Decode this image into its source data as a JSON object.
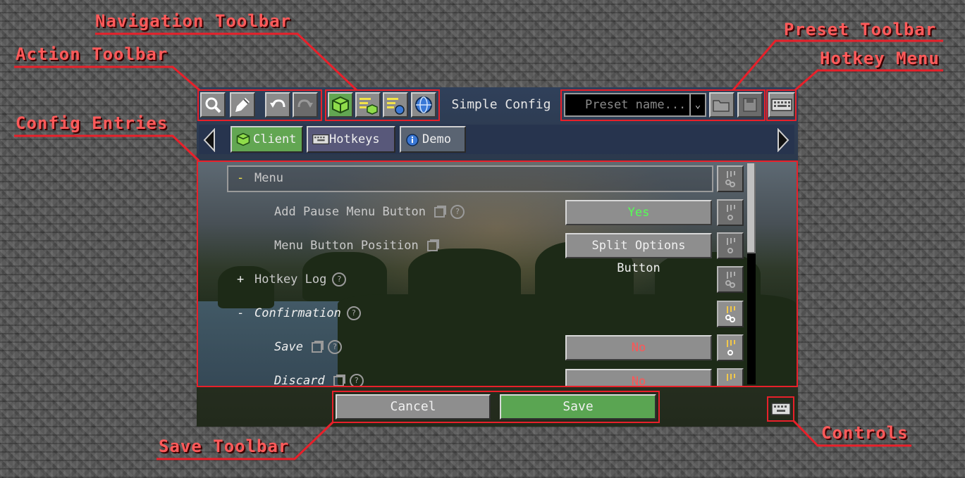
{
  "annotations": {
    "navigation_toolbar": "Navigation Toolbar",
    "action_toolbar": "Action Toolbar",
    "config_entries": "Config Entries",
    "preset_toolbar": "Preset Toolbar",
    "hotkey_menu": "Hotkey Menu",
    "save_toolbar": "Save Toolbar",
    "controls": "Controls"
  },
  "header": {
    "title": "Simple Config",
    "preset_placeholder": "Preset name..."
  },
  "tabs": [
    {
      "label": "Client",
      "icon": "cube-icon",
      "selected": true
    },
    {
      "label": "Hotkeys",
      "icon": "keyboard-icon",
      "selected": false
    },
    {
      "label": "Demo",
      "icon": "info-icon",
      "selected": false
    }
  ],
  "entries": {
    "menu": {
      "toggle": "-",
      "label": "Menu"
    },
    "add_pause": {
      "label": "Add Pause Menu Button",
      "value": "Yes"
    },
    "menu_position": {
      "label": "Menu Button Position",
      "value": "Split Options Button"
    },
    "hotkey_log": {
      "toggle": "+",
      "label": "Hotkey Log"
    },
    "confirmation": {
      "toggle": "-",
      "label": "Confirmation"
    },
    "save": {
      "label": "Save",
      "value": "No"
    },
    "discard": {
      "label": "Discard",
      "value": "No"
    }
  },
  "footer": {
    "cancel": "Cancel",
    "save": "Save"
  },
  "colors": {
    "annotation": "#ff5a5a",
    "yes": "#55ff55",
    "no": "#ff5555",
    "save_button": "#5aa552"
  }
}
